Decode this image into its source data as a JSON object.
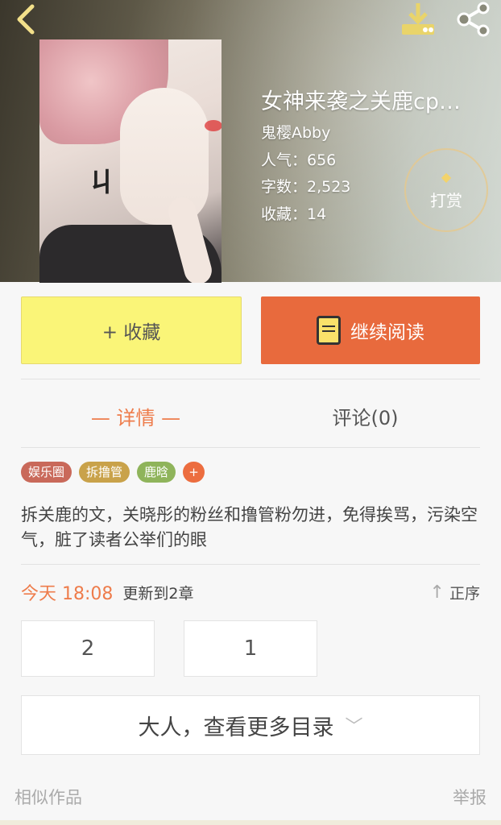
{
  "header": {
    "title": "女神来袭之关鹿cp…",
    "author": "鬼樱Abby",
    "popularity": "人气：656",
    "word_count": "字数：2,523",
    "favorites": "收藏：14",
    "reward_label": "打赏"
  },
  "actions": {
    "favorite_label": "+ 收藏",
    "continue_label": "继续阅读"
  },
  "tabs": {
    "detail": "— 详情 —",
    "comments": "评论(0)"
  },
  "tags": [
    {
      "label": "娱乐圈",
      "color": "#c9695a"
    },
    {
      "label": "拆撸管",
      "color": "#c9a24a"
    },
    {
      "label": "鹿晗",
      "color": "#8fb45b"
    }
  ],
  "tag_add": "+",
  "description": "拆关鹿的文，关晓彤的粉丝和撸管粉勿进，免得挨骂，污染空气，脏了读者公举们的眼",
  "update": {
    "time": "今天 18:08",
    "text": "更新到2章",
    "sort_label": "正序"
  },
  "chapters": [
    "2",
    "1"
  ],
  "more_label": "大人，查看更多目录",
  "footer": {
    "similar": "相似作品",
    "report": "举报"
  },
  "colors": {
    "accent": "#e86a3d",
    "favorite_bg": "#faf578"
  }
}
